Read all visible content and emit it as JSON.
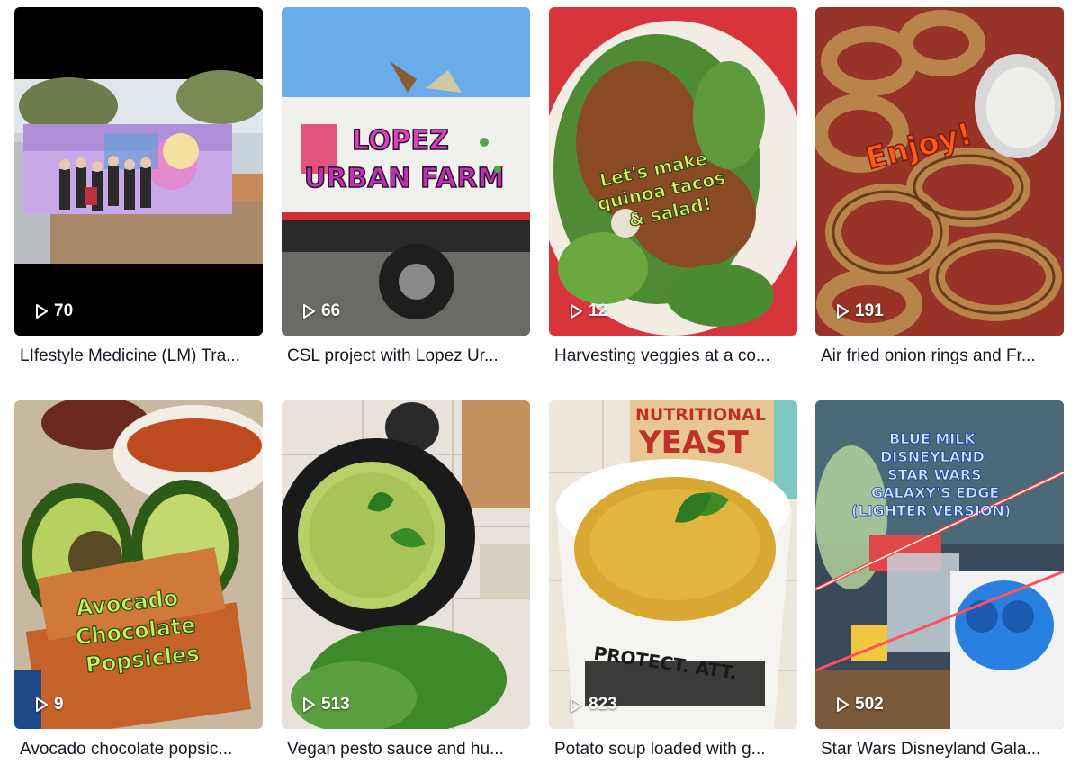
{
  "videos": [
    {
      "views": "70",
      "caption": "LIfestyle Medicine (LM) Tra...",
      "overlay": []
    },
    {
      "views": "66",
      "caption": "CSL project with Lopez Ur...",
      "overlay": [
        "LOPEZ",
        "URBAN FARM"
      ]
    },
    {
      "views": "12",
      "caption": "Harvesting veggies at a co...",
      "overlay": [
        "Let's make",
        "quinoa tacos",
        "& salad!"
      ]
    },
    {
      "views": "191",
      "caption": "Air fried onion rings and Fr...",
      "overlay": [
        "Enjoy!"
      ]
    },
    {
      "views": "9",
      "caption": "Avocado chocolate popsic...",
      "overlay": [
        "Avocado",
        "Chocolate",
        "Popsicles"
      ]
    },
    {
      "views": "513",
      "caption": "Vegan pesto sauce and hu...",
      "overlay": []
    },
    {
      "views": "823",
      "caption": "Potato soup loaded with g...",
      "overlay": [
        "NUTRITIONAL",
        "YEAST",
        "PROTECT. ATT."
      ]
    },
    {
      "views": "502",
      "caption": "Star Wars Disneyland Gala...",
      "overlay": [
        "BLUE MILK",
        "DISNEYLAND",
        "STAR WARS",
        "GALAXY'S EDGE",
        "(LIGHTER VERSION)"
      ]
    }
  ],
  "icons": {
    "view_count": "play-outline-icon"
  }
}
